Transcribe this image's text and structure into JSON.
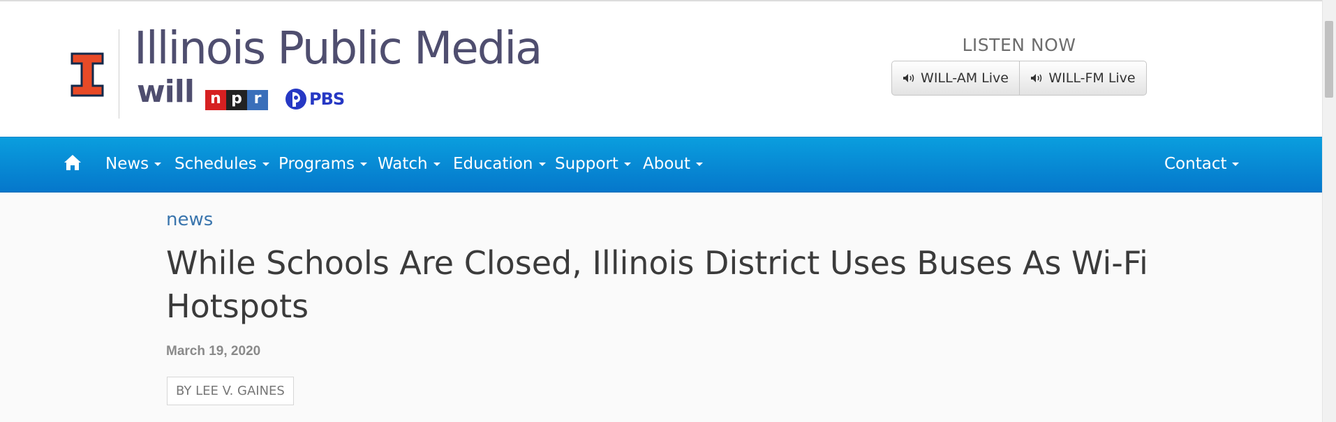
{
  "brand": {
    "title": "Illinois Public Media",
    "will": "will",
    "npr": [
      "n",
      "p",
      "r"
    ],
    "pbs": "PBS",
    "logo_icon": "block-i-logo",
    "colors": {
      "block_i": "#e84a27",
      "block_i_outline": "#13294b",
      "title": "#4f4e6f",
      "npr_red": "#d62021",
      "npr_black": "#222222",
      "npr_blue": "#3a6fba",
      "pbs": "#2638c4"
    }
  },
  "listen": {
    "label": "LISTEN NOW",
    "buttons": [
      {
        "label": "WILL-AM Live",
        "icon": "speaker-icon"
      },
      {
        "label": "WILL-FM Live",
        "icon": "speaker-icon"
      }
    ]
  },
  "nav": {
    "home_icon": "home-icon",
    "items": [
      {
        "label": "News"
      },
      {
        "label": "Schedules"
      },
      {
        "label": "Programs"
      },
      {
        "label": "Watch"
      },
      {
        "label": "Education"
      },
      {
        "label": "Support"
      },
      {
        "label": "About"
      }
    ],
    "contact": {
      "label": "Contact"
    },
    "colors": {
      "bar_top": "#0a9ede",
      "bar_bottom": "#0577cb",
      "text": "#ffffff"
    }
  },
  "article": {
    "section": "news",
    "headline": "While Schools Are Closed, Illinois District Uses Buses As Wi-Fi Hotspots",
    "date": "March 19, 2020",
    "byline": "BY LEE V. GAINES",
    "colors": {
      "section": "#3a75ad",
      "headline": "#3b3b3b"
    }
  }
}
